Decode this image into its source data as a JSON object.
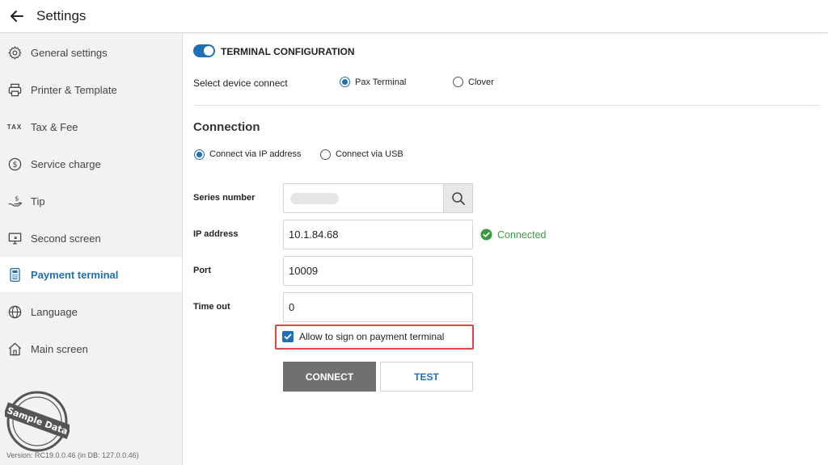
{
  "header": {
    "title": "Settings"
  },
  "sidebar": {
    "items": [
      {
        "label": "General settings",
        "icon": "gear-icon"
      },
      {
        "label": "Printer & Template",
        "icon": "printer-icon"
      },
      {
        "label": "Tax & Fee",
        "icon": "tax-icon",
        "icon_text": "TAX"
      },
      {
        "label": "Service charge",
        "icon": "dollar-circle-icon"
      },
      {
        "label": "Tip",
        "icon": "hand-dollar-icon"
      },
      {
        "label": "Second screen",
        "icon": "monitor-icon"
      },
      {
        "label": "Payment terminal",
        "icon": "terminal-icon",
        "active": true
      },
      {
        "label": "Language",
        "icon": "globe-icon"
      },
      {
        "label": "Main screen",
        "icon": "home-icon"
      }
    ],
    "stamp_text": "Sample Data",
    "version": "Version:  RC19.0.0.46 (in DB: 127.0.0.46)"
  },
  "terminal": {
    "toggle_on": true,
    "title": "TERMINAL CONFIGURATION",
    "device_label": "Select device connect",
    "device_options": [
      {
        "label": "Pax Terminal",
        "selected": true
      },
      {
        "label": "Clover",
        "selected": false
      }
    ]
  },
  "connection": {
    "title": "Connection",
    "modes": [
      {
        "label": "Connect via IP address",
        "selected": true
      },
      {
        "label": "Connect via USB",
        "selected": false
      }
    ],
    "fields": {
      "series_label": "Series number",
      "ip_label": "IP address",
      "ip_value": "10.1.84.68",
      "port_label": "Port",
      "port_value": "10009",
      "timeout_label": "Time out",
      "timeout_value": "0"
    },
    "status": "Connected",
    "allow_sign_label": "Allow to sign on payment terminal",
    "allow_sign_checked": true,
    "connect_button": "CONNECT",
    "test_button": "TEST"
  },
  "colors": {
    "accent": "#1e6fb5",
    "success": "#3a9a40",
    "highlight": "#e04444"
  }
}
